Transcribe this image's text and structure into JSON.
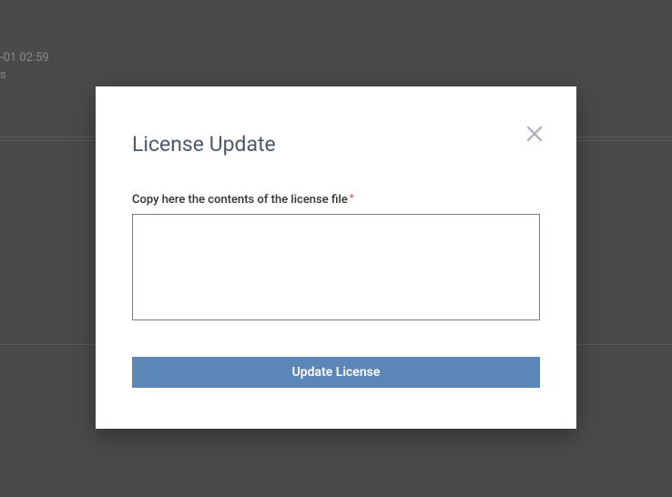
{
  "background": {
    "timestamp_fragment": "-01 02:59",
    "row_fragment": "s"
  },
  "modal": {
    "title": "License Update",
    "close_label": "Close",
    "field_label": "Copy here the contents of the license file",
    "required_marker": "*",
    "textarea_value": "",
    "submit_label": "Update License"
  }
}
